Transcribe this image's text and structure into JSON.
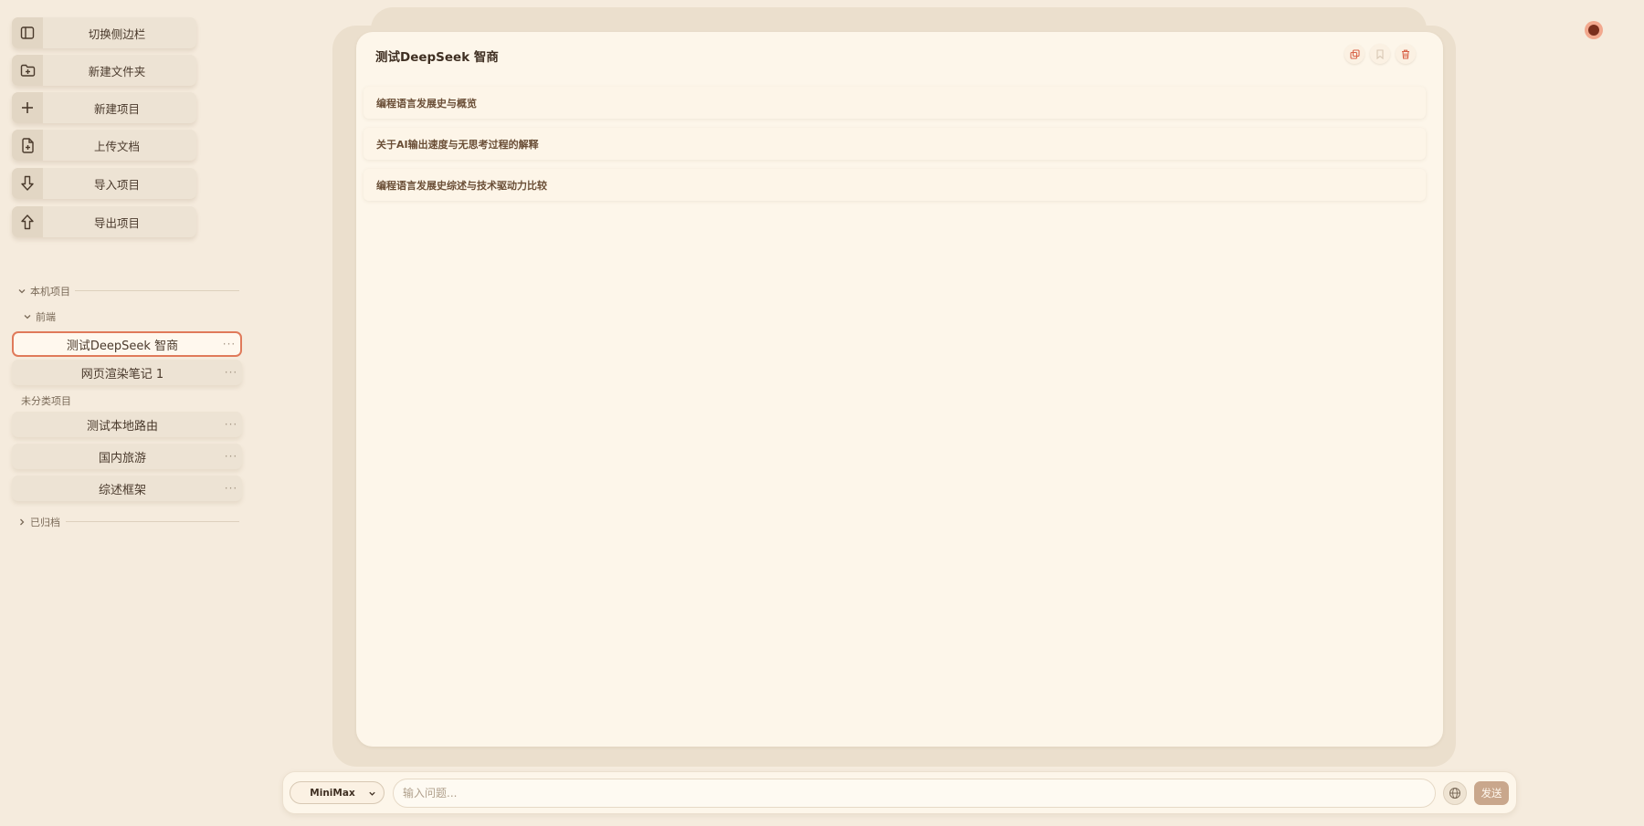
{
  "sidebar": {
    "actions": [
      {
        "label": "切换侧边栏",
        "icon": "sidebar-toggle-icon"
      },
      {
        "label": "新建文件夹",
        "icon": "folder-plus-icon"
      },
      {
        "label": "新建项目",
        "icon": "plus-icon"
      },
      {
        "label": "上传文档",
        "icon": "file-plus-icon"
      },
      {
        "label": "导入项目",
        "icon": "arrow-down-icon"
      },
      {
        "label": "导出项目",
        "icon": "arrow-up-icon"
      }
    ],
    "local_section": "本机项目",
    "folder": "前端",
    "folder_items": [
      {
        "label": "测试DeepSeek 智商",
        "more": "···"
      },
      {
        "label": "网页渲染笔记 1",
        "more": "···"
      }
    ],
    "uncategorized_label": "未分类项目",
    "uncategorized_items": [
      {
        "label": "测试本地路由",
        "more": "···"
      },
      {
        "label": "国内旅游",
        "more": "···"
      },
      {
        "label": "综述框架",
        "more": "···"
      }
    ],
    "archived_section": "已归档"
  },
  "main": {
    "title": "测试DeepSeek 智商",
    "tools": [
      "copy-icon",
      "bookmark-icon",
      "trash-icon"
    ],
    "conversations": [
      "编程语言发展史与概览",
      "关于AI输出速度与无思考过程的解释",
      "编程语言发展史综述与技术驱动力比较"
    ]
  },
  "input_bar": {
    "model": "MiniMax",
    "placeholder": "输入问题...",
    "send_label": "发送"
  },
  "colors": {
    "background": "#f5ebdd",
    "card": "#fdf6ea",
    "accent": "#e07a5a",
    "send_button": "#c9a78c",
    "status_dot": "#7a2e1c"
  }
}
